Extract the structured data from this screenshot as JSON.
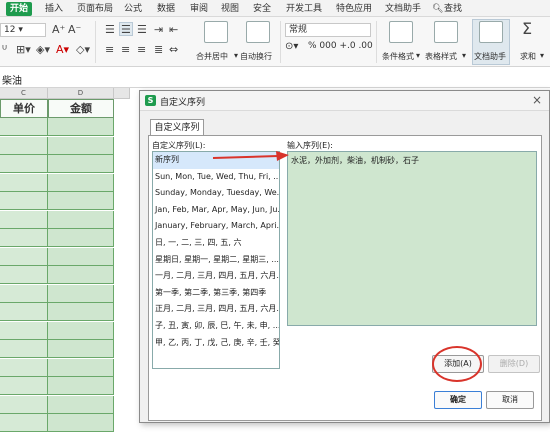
{
  "menu": {
    "tabs": [
      "开始",
      "插入",
      "页面布局",
      "公式",
      "数据",
      "审阅",
      "视图",
      "安全",
      "开发工具",
      "特色应用",
      "文档助手"
    ],
    "search": "查找"
  },
  "toolbar": {
    "font_size": "12",
    "merge_label": "合并居中",
    "wrap_label": "自动换行",
    "number_format": "常规",
    "number_symbols": "% 000 +.0 .00",
    "conditional_label": "条件格式",
    "table_style_label": "表格样式",
    "doc_helper_label": "文档助手",
    "sum_label": "求和"
  },
  "formula": {
    "text": "柴油"
  },
  "grid": {
    "col_c": "C",
    "col_d": "D",
    "header_price": "单价",
    "header_amount": "金额"
  },
  "dialog": {
    "logo": "S",
    "title": "自定义序列",
    "close": "×",
    "tab": "自定义序列",
    "list_label": "自定义序列(L):",
    "input_label": "输入序列(E):",
    "list_items": [
      "新序列",
      "Sun, Mon, Tue, Wed, Thu, Fri, ...",
      "Sunday, Monday, Tuesday, We...",
      "Jan, Feb, Mar, Apr, May, Jun, Ju...",
      "January, February, March, Apri...",
      "日, 一, 二, 三, 四, 五, 六",
      "星期日, 星期一, 星期二, 星期三, ...",
      "一月, 二月, 三月, 四月, 五月, 六月...",
      "第一季, 第二季, 第三季, 第四季",
      "正月, 二月, 三月, 四月, 五月, 六月...",
      "子, 丑, 寅, 卯, 辰, 巳, 午, 未, 申, ...",
      "甲, 乙, 丙, 丁, 戊, 己, 庚, 辛, 壬, 癸"
    ],
    "entries": "水泥，外加剂，柴油，机制砂，石子",
    "add": "添加(A)",
    "delete": "删除(D)",
    "ok": "确定",
    "cancel": "取消"
  },
  "colors": {
    "accent": "#1e9b4e",
    "cell_green": "#d6ead6",
    "annotation_red": "#d9342b"
  }
}
